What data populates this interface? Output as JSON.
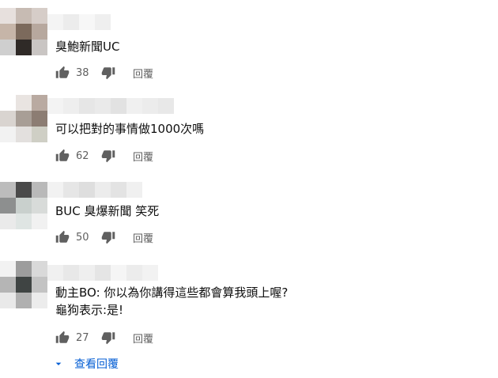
{
  "comments": [
    {
      "text": "臭鮑新聞UC",
      "likes": "38",
      "reply_label": "回覆",
      "avatar_colors": [
        "#e7e0dd",
        "#c7bbb3",
        "#d6cdc8",
        "#c6b5a8",
        "#7c6a5c",
        "#b7a89e",
        "#cfcfcf",
        "#2f2a27",
        "#c9c5c3"
      ],
      "name_blur_colors": [
        "#f4f4f4",
        "#ececec",
        "#f7f7f7",
        "#efefef"
      ]
    },
    {
      "text": "可以把對的事情做1000次嗎",
      "likes": "62",
      "reply_label": "回覆",
      "avatar_colors": [
        "#ffffff",
        "#e9e4e1",
        "#b9aaa1",
        "#d9d4d0",
        "#a89e96",
        "#8c7d73",
        "#f2f2f2",
        "#e3e0de",
        "#cfcfc5"
      ],
      "name_blur_colors": [
        "#f3f3f3",
        "#eeeeee",
        "#e6e6e6",
        "#eaeaea",
        "#e2e2e2",
        "#f0f0f0",
        "#ececec",
        "#e8e8e8"
      ]
    },
    {
      "text": "BUC 臭爆新聞 笑死",
      "likes": "50",
      "reply_label": "回覆",
      "avatar_colors": [
        "#bcbcbc",
        "#4a4a4a",
        "#b9b9b9",
        "#8d8f8f",
        "#c9d0cd",
        "#d8dbd9",
        "#eaeaea",
        "#dfe5e3",
        "#f1f1f1"
      ],
      "name_blur_colors": [
        "#f2f2f2",
        "#e6e6e6",
        "#dedede",
        "#ececec",
        "#e3e3e3",
        "#f0f0f0"
      ]
    },
    {
      "text": "動主BO: 你以為你講得這些都會算我頭上喔?\n龜狗表示:是!",
      "likes": "27",
      "reply_label": "回覆",
      "avatar_colors": [
        "#f2f2f2",
        "#9d9d9d",
        "#d9d9d9",
        "#b5b5b5",
        "#3f4443",
        "#c3c3c3",
        "#e9e9e9",
        "#b0b0b0",
        "#ececec"
      ],
      "name_blur_colors": [
        "#f0f0f0",
        "#e8e8e8",
        "#efefef",
        "#e5e5e5",
        "#f5f5f5",
        "#ececec",
        "#f2f2f2"
      ]
    }
  ],
  "view_replies_label": "查看回覆",
  "colors": {
    "link": "#065fd4",
    "meta": "#606060",
    "icon": "#606060"
  },
  "icons": {
    "like": "thumbs-up-icon",
    "dislike": "thumbs-down-icon",
    "expand": "caret-down-icon"
  }
}
